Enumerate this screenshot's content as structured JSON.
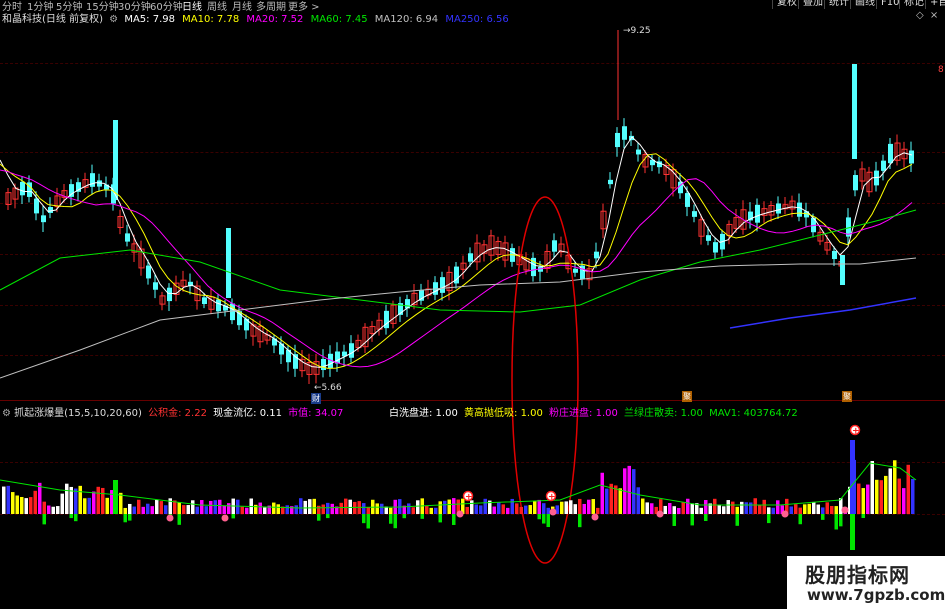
{
  "periods": [
    {
      "label": "分时",
      "active": false
    },
    {
      "label": "1分钟",
      "active": false
    },
    {
      "label": "5分钟",
      "active": false
    },
    {
      "label": "15分钟",
      "active": false
    },
    {
      "label": "30分钟",
      "active": false
    },
    {
      "label": "60分钟",
      "active": false
    },
    {
      "label": "日线",
      "active": true
    },
    {
      "label": "周线",
      "active": false
    },
    {
      "label": "月线",
      "active": false
    },
    {
      "label": "多周期",
      "active": false
    },
    {
      "label": "更多 >",
      "active": false
    }
  ],
  "right_buttons": [
    "复权",
    "叠加",
    "统计",
    "画线",
    "F10",
    "标记",
    "+自"
  ],
  "main_legend": {
    "stock": "和晶科技(日线 前复权)",
    "ma5": "MA5: 7.98",
    "ma10": "MA10: 7.78",
    "ma20": "MA20: 7.52",
    "ma60": "MA60: 7.45",
    "ma120": "MA120: 6.94",
    "ma250": "MA250: 6.56"
  },
  "main_annotations": {
    "high_label": "9.25",
    "low_label": "5.66",
    "edge_label": "8",
    "cai_marker": "财",
    "ju_marker_1": "聚",
    "ju_marker_2": "聚"
  },
  "indicator_legend": {
    "name": "抓起涨爆量(15,5,10,20,60)",
    "gongjijin": "公积金: 2.22",
    "xianjin": "现金流亿: 0.11",
    "shizhi": "市值: 34.07",
    "baixi": "白洗盘进: 1.00",
    "huanggao": "黄高抛低吸: 1.00",
    "fenzhuang": "粉庄进盘: 1.00",
    "lanlv": "兰绿庄散卖: 1.00",
    "mav1": "MAV1: 403764.72"
  },
  "colors": {
    "up": "#ff3232",
    "down": "#54ffff",
    "ma5": "#ffffff",
    "ma10": "#ffff00",
    "ma20": "#ff00ff",
    "ma60": "#00e600",
    "ma120": "#c0c0c0",
    "ma250": "#3333ff",
    "circle": "#e00000"
  },
  "watermark": {
    "line1": "股朋指标网",
    "line2": "www.7gpzb.com"
  }
}
